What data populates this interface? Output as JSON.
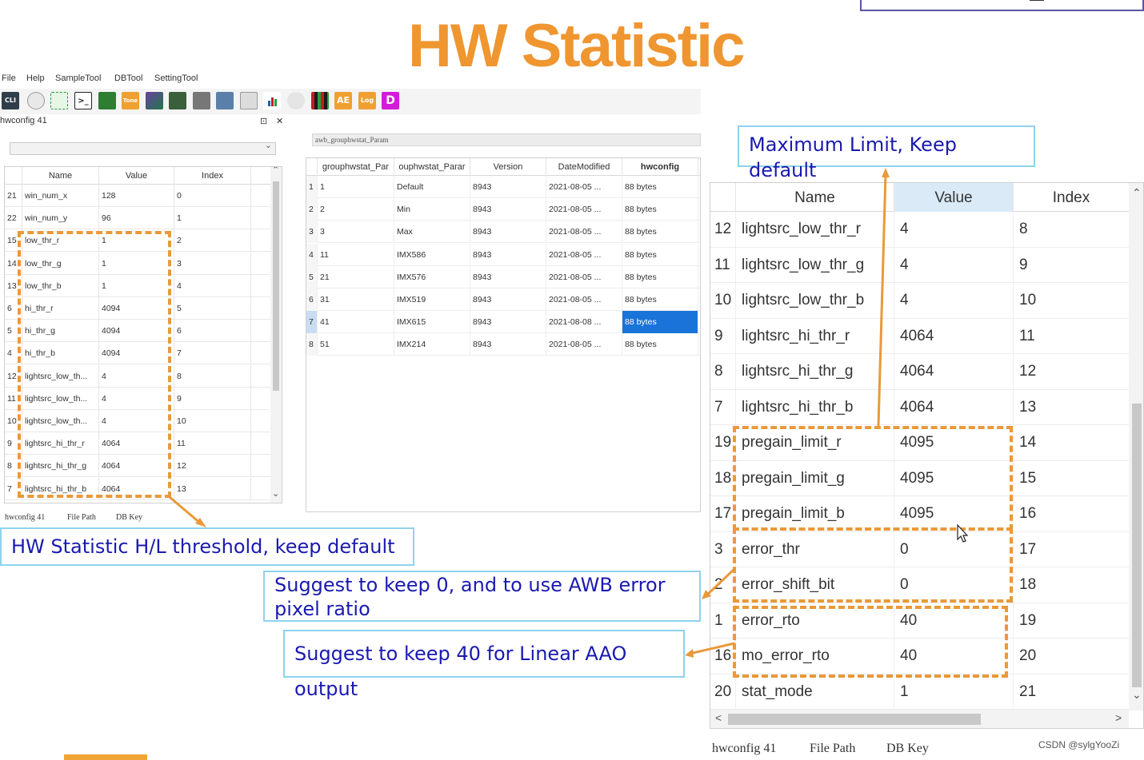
{
  "title": "HW Statistic",
  "menu": [
    "File",
    "Help",
    "SampleTool",
    "DBTool",
    "SettingTool"
  ],
  "toolbar": {
    "icons": [
      "cli-icon",
      "sphere-icon",
      "crosshair-icon",
      "terminal-icon",
      "tree-icon",
      "tone-icon",
      "image-icon",
      "grid-image-icon",
      "tools-icon",
      "camera-icon",
      "table-icon",
      "bars-icon",
      "gear-icon",
      "mosaic-icon",
      "ae-icon",
      "log-icon",
      "d-icon"
    ],
    "labels": {
      "cli": "CLI",
      "tone": "Tone",
      "ae": "AE",
      "log": "Log",
      "d": "D"
    }
  },
  "left_pane": {
    "title": "hwconfig 41",
    "pin": "⊡",
    "close": "✕",
    "columns": [
      "Name",
      "Value",
      "Index"
    ],
    "rows": [
      {
        "no": "21",
        "name": "win_num_x",
        "value": "128",
        "index": "0"
      },
      {
        "no": "22",
        "name": "win_num_y",
        "value": "96",
        "index": "1"
      },
      {
        "no": "15",
        "name": "low_thr_r",
        "value": "1",
        "index": "2"
      },
      {
        "no": "14",
        "name": "low_thr_g",
        "value": "1",
        "index": "3"
      },
      {
        "no": "13",
        "name": "low_thr_b",
        "value": "1",
        "index": "4"
      },
      {
        "no": "6",
        "name": "hi_thr_r",
        "value": "4094",
        "index": "5"
      },
      {
        "no": "5",
        "name": "hi_thr_g",
        "value": "4094",
        "index": "6"
      },
      {
        "no": "4",
        "name": "hi_thr_b",
        "value": "4094",
        "index": "7"
      },
      {
        "no": "12",
        "name": "lightsrc_low_th...",
        "value": "4",
        "index": "8"
      },
      {
        "no": "11",
        "name": "lightsrc_low_th...",
        "value": "4",
        "index": "9"
      },
      {
        "no": "10",
        "name": "lightsrc_low_th...",
        "value": "4",
        "index": "10"
      },
      {
        "no": "9",
        "name": "lightsrc_hi_thr_r",
        "value": "4064",
        "index": "11"
      },
      {
        "no": "8",
        "name": "lightsrc_hi_thr_g",
        "value": "4064",
        "index": "12"
      },
      {
        "no": "7",
        "name": "lightsrc_hi_thr_b",
        "value": "4064",
        "index": "13"
      }
    ],
    "tabs": [
      "hwconfig 41",
      "File Path",
      "DB Key"
    ]
  },
  "mid_pane": {
    "label": "awb_grouphwstat_Param",
    "columns": [
      "grouphwstat_Par",
      "ouphwstat_Parar",
      "Version",
      "DateModified",
      "hwconfig"
    ],
    "rows": [
      {
        "no": "1",
        "id": "1",
        "name": "Default",
        "version": "8943",
        "date": "2021-08-05 ...",
        "hw": "88 bytes"
      },
      {
        "no": "2",
        "id": "2",
        "name": "Min",
        "version": "8943",
        "date": "2021-08-05 ...",
        "hw": "88 bytes"
      },
      {
        "no": "3",
        "id": "3",
        "name": "Max",
        "version": "8943",
        "date": "2021-08-05 ...",
        "hw": "88 bytes"
      },
      {
        "no": "4",
        "id": "11",
        "name": "IMX586",
        "version": "8943",
        "date": "2021-08-05 ...",
        "hw": "88 bytes"
      },
      {
        "no": "5",
        "id": "21",
        "name": "IMX576",
        "version": "8943",
        "date": "2021-08-05 ...",
        "hw": "88 bytes"
      },
      {
        "no": "6",
        "id": "31",
        "name": "IMX519",
        "version": "8943",
        "date": "2021-08-05 ...",
        "hw": "88 bytes"
      },
      {
        "no": "7",
        "id": "41",
        "name": "IMX615",
        "version": "8943",
        "date": "2021-08-08 ...",
        "hw": "88 bytes"
      },
      {
        "no": "8",
        "id": "51",
        "name": "IMX214",
        "version": "8943",
        "date": "2021-08-05 ...",
        "hw": "88 bytes"
      }
    ],
    "selected_row": 6
  },
  "right_pane": {
    "columns": [
      "Name",
      "Value",
      "Index"
    ],
    "rows": [
      {
        "no": "12",
        "name": "lightsrc_low_thr_r",
        "value": "4",
        "index": "8"
      },
      {
        "no": "11",
        "name": "lightsrc_low_thr_g",
        "value": "4",
        "index": "9"
      },
      {
        "no": "10",
        "name": "lightsrc_low_thr_b",
        "value": "4",
        "index": "10"
      },
      {
        "no": "9",
        "name": "lightsrc_hi_thr_r",
        "value": "4064",
        "index": "11"
      },
      {
        "no": "8",
        "name": "lightsrc_hi_thr_g",
        "value": "4064",
        "index": "12"
      },
      {
        "no": "7",
        "name": "lightsrc_hi_thr_b",
        "value": "4064",
        "index": "13"
      },
      {
        "no": "19",
        "name": "pregain_limit_r",
        "value": "4095",
        "index": "14"
      },
      {
        "no": "18",
        "name": "pregain_limit_g",
        "value": "4095",
        "index": "15"
      },
      {
        "no": "17",
        "name": "pregain_limit_b",
        "value": "4095",
        "index": "16"
      },
      {
        "no": "3",
        "name": "error_thr",
        "value": "0",
        "index": "17"
      },
      {
        "no": "2",
        "name": "error_shift_bit",
        "value": "0",
        "index": "18"
      },
      {
        "no": "1",
        "name": "error_rto",
        "value": "40",
        "index": "19"
      },
      {
        "no": "16",
        "name": "mo_error_rto",
        "value": "40",
        "index": "20"
      },
      {
        "no": "20",
        "name": "stat_mode",
        "value": "1",
        "index": "21"
      }
    ],
    "tabs": [
      "hwconfig 41",
      "File Path",
      "DB Key"
    ]
  },
  "callouts": {
    "max_limit": "Maximum Limit, Keep default",
    "hl_threshold": "HW Statistic H/L threshold, keep default",
    "keep_zero": "Suggest to keep 0, and to use AWB error pixel ratio",
    "keep_forty": "Suggest to keep 40 for Linear AAO output"
  },
  "watermark": "CSDN @sylgYooZi",
  "colors": {
    "title": "#ef9630",
    "callout_text": "#1a1ab0",
    "callout_border": "#8ed3ee",
    "dash": "#e9993a",
    "selection": "#1a73d9"
  }
}
